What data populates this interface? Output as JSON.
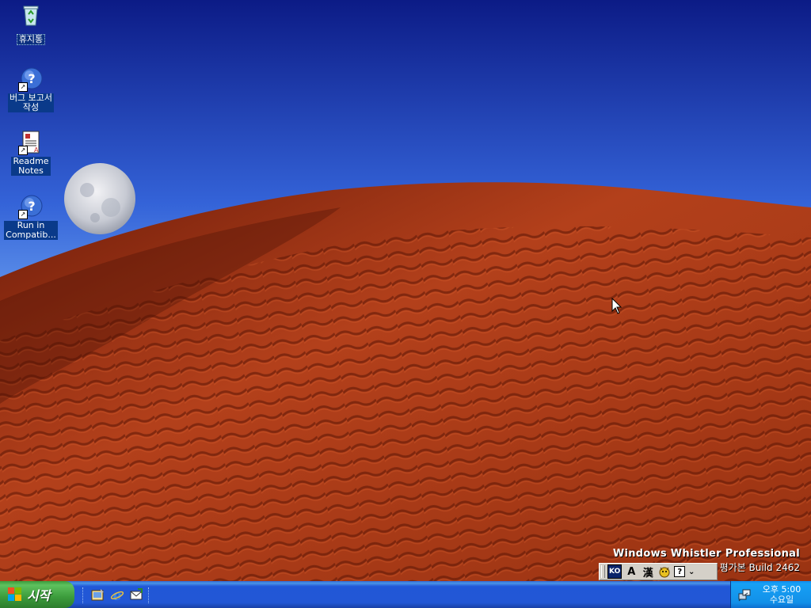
{
  "desktop": {
    "icons": [
      {
        "label": "휴지통",
        "icon": "recycle-bin-icon"
      },
      {
        "label": "버그 보고서\n작성",
        "icon": "help-shortcut-icon"
      },
      {
        "label": "Readme\nNotes",
        "icon": "document-shortcut-icon"
      },
      {
        "label": "Run in\nCompatib...",
        "icon": "help-shortcut-icon"
      }
    ],
    "watermark": {
      "line1": "Windows Whistler Professional",
      "line2": "평가본  Build 2462"
    }
  },
  "language_bar": {
    "lang": "KO",
    "input_mode": "A",
    "hanja": "漢",
    "help": "?",
    "menu": "⌄"
  },
  "taskbar": {
    "start_label": "시작",
    "quick_launch": [
      "show-desktop-icon",
      "internet-explorer-icon",
      "outlook-express-icon"
    ],
    "clock": {
      "time": "오후 5:00",
      "day": "수요일"
    }
  },
  "colors": {
    "taskbar": "#2257d5",
    "start": "#3b9b3b",
    "tray": "#1290e8",
    "sky": "#3a6be0",
    "sand": "#b8401a"
  }
}
